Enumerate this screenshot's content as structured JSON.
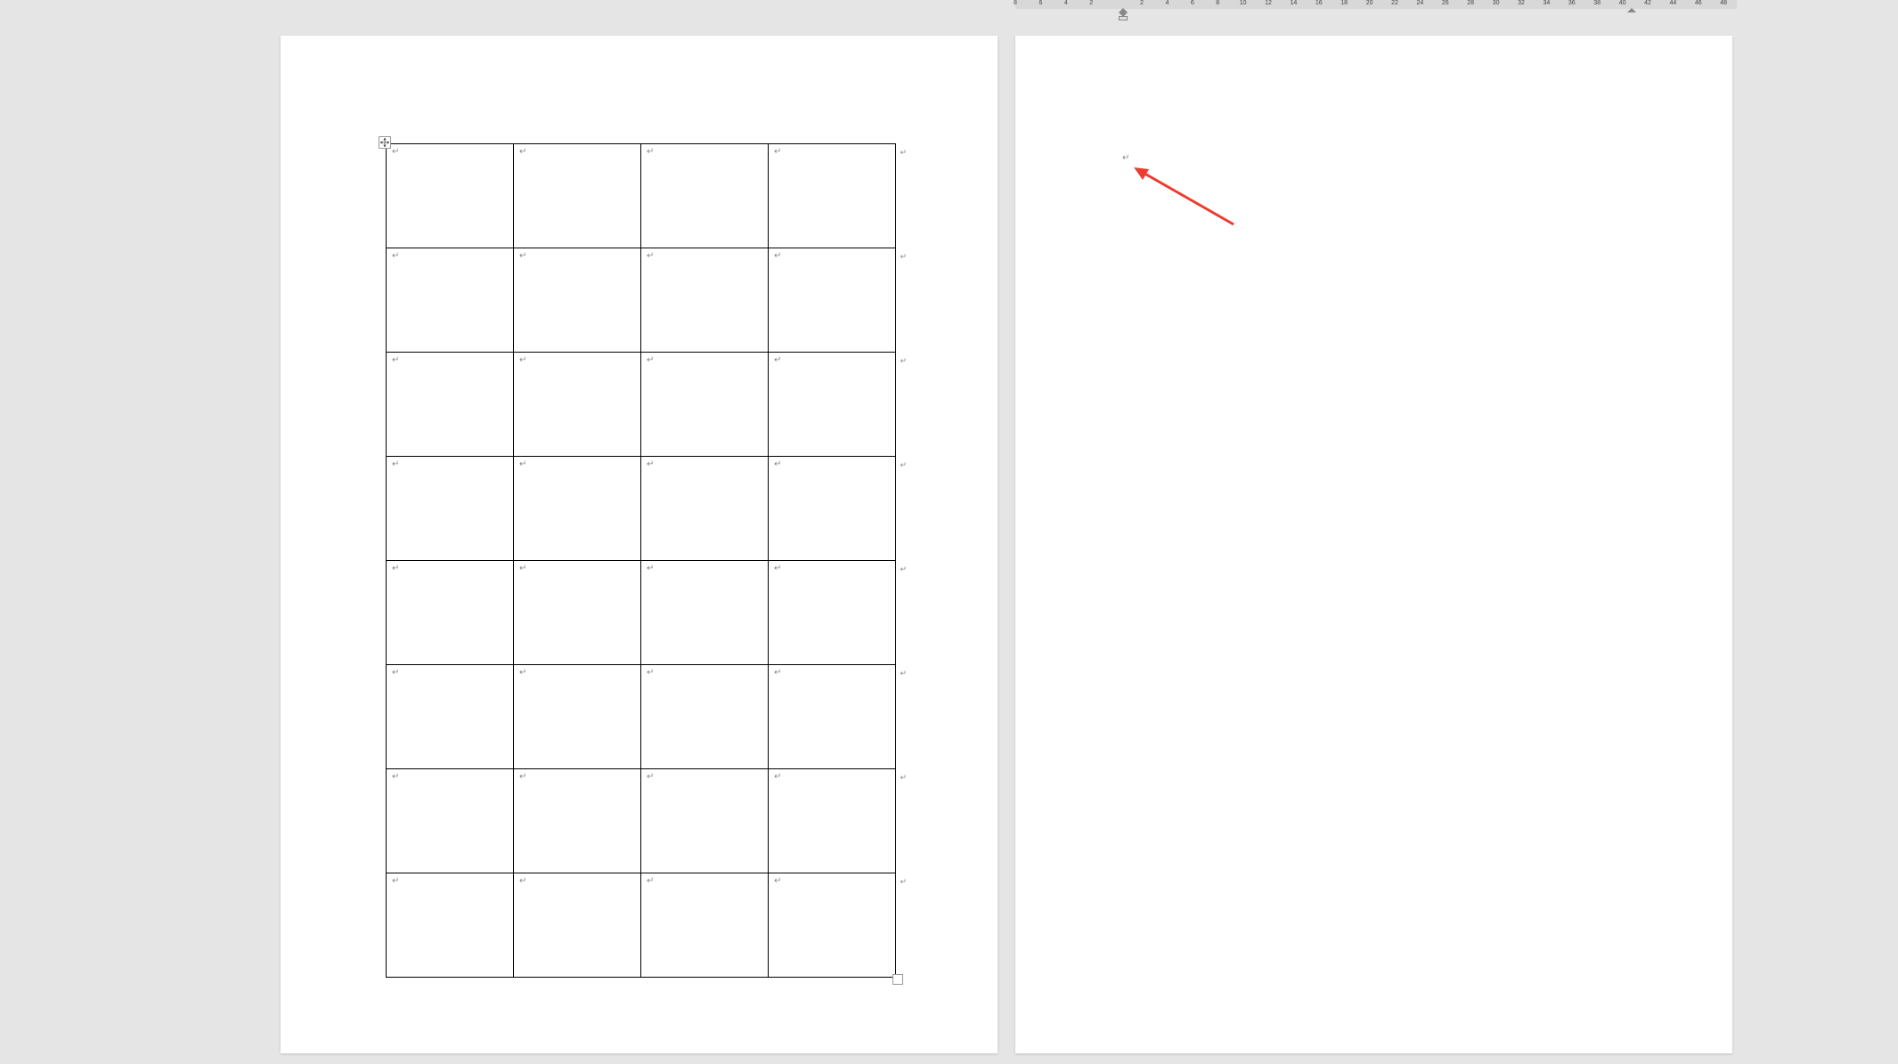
{
  "ruler": {
    "ticks": [
      "8",
      "6",
      "4",
      "2",
      "",
      "2",
      "4",
      "6",
      "8",
      "10",
      "12",
      "14",
      "16",
      "18",
      "20",
      "22",
      "24",
      "26",
      "28",
      "30",
      "32",
      "34",
      "36",
      "38",
      "40",
      "42",
      "44",
      "46",
      "48"
    ]
  },
  "table": {
    "rows": 8,
    "cols": 4,
    "cell_mark": "↵",
    "row_end_mark": "↵"
  },
  "page2": {
    "cursor_mark": "↵"
  },
  "annotation": {
    "arrow_color": "#ED3B2F"
  }
}
